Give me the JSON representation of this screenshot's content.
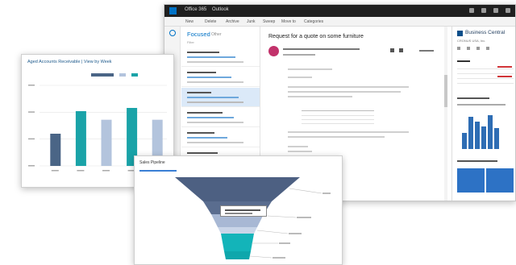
{
  "outlook": {
    "app_name": "Office 365",
    "app_label": "Outlook",
    "toolbar": [
      "New",
      "Delete",
      "Archive",
      "Junk",
      "Sweep",
      "Move to",
      "Categories"
    ],
    "mail_list": {
      "focused": "Focused",
      "other": "Other",
      "filter": "Filter"
    },
    "message": {
      "subject": "Request for a quote on some furniture"
    }
  },
  "business_central": {
    "title": "Business Central",
    "company": "CRONUS USA, Inc."
  },
  "ar_chart": {
    "title": "Aged Accounts Receivable | View by Week"
  },
  "sales_pipeline": {
    "title": "Sales Pipeline"
  },
  "colors": {
    "dark_bar": "#4a6586",
    "teal_bar": "#1aa3a8",
    "light_bar": "#b3c4dd",
    "funnel_top": "#4d6082",
    "funnel_mid": "#a8b8d4",
    "funnel_low": "#13b4b9",
    "outlook_blue": "#0072c6"
  },
  "chart_data": {
    "type": "bar",
    "categories": [
      "",
      "",
      "",
      "",
      ""
    ],
    "series": [
      {
        "values": [
          300,
          0,
          0,
          0,
          0
        ]
      },
      {
        "values": [
          0,
          510,
          0,
          540,
          0
        ]
      },
      {
        "values": [
          0,
          0,
          430,
          0,
          430
        ]
      }
    ],
    "title": "Aged Accounts Receivable | View by Week",
    "xlabel": "",
    "ylabel": "",
    "ylim": [
      0,
      750
    ]
  }
}
